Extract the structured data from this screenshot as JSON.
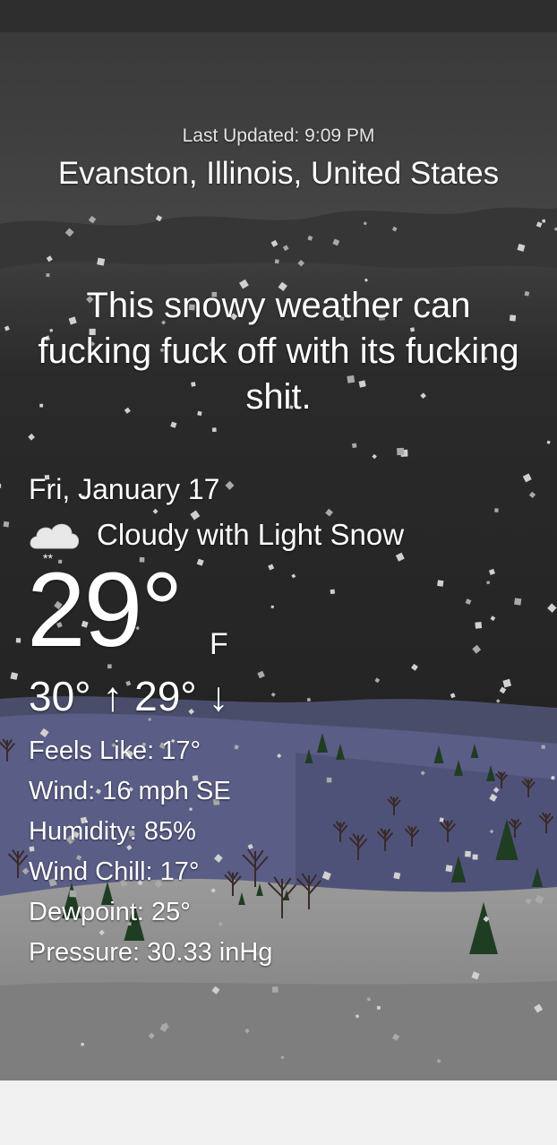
{
  "header": {
    "last_updated": "Last Updated: 9:09 PM",
    "location": "Evanston, Illinois, United States"
  },
  "headline": "This snowy weather can fucking fuck off with its fucking shit.",
  "current": {
    "date": "Fri, January 17",
    "condition": "Cloudy with Light Snow",
    "condition_icon": "cloud-snow-icon",
    "temperature": "29°",
    "unit": "F",
    "hilo": "30° ↑ 29° ↓"
  },
  "details": [
    "Feels Like: 17°",
    "Wind: 16 mph SE",
    "Humidity: 85%",
    "Wind Chill: 17°",
    "Dewpoint: 25°",
    "Pressure: 30.33 inHg"
  ],
  "colors": {
    "sky_top": "#3c3c3c",
    "sky_bottom": "#222222",
    "hill_blue": "#585a82",
    "snow_ground": "#8a8a8a",
    "tree_green": "#1f3d22"
  }
}
